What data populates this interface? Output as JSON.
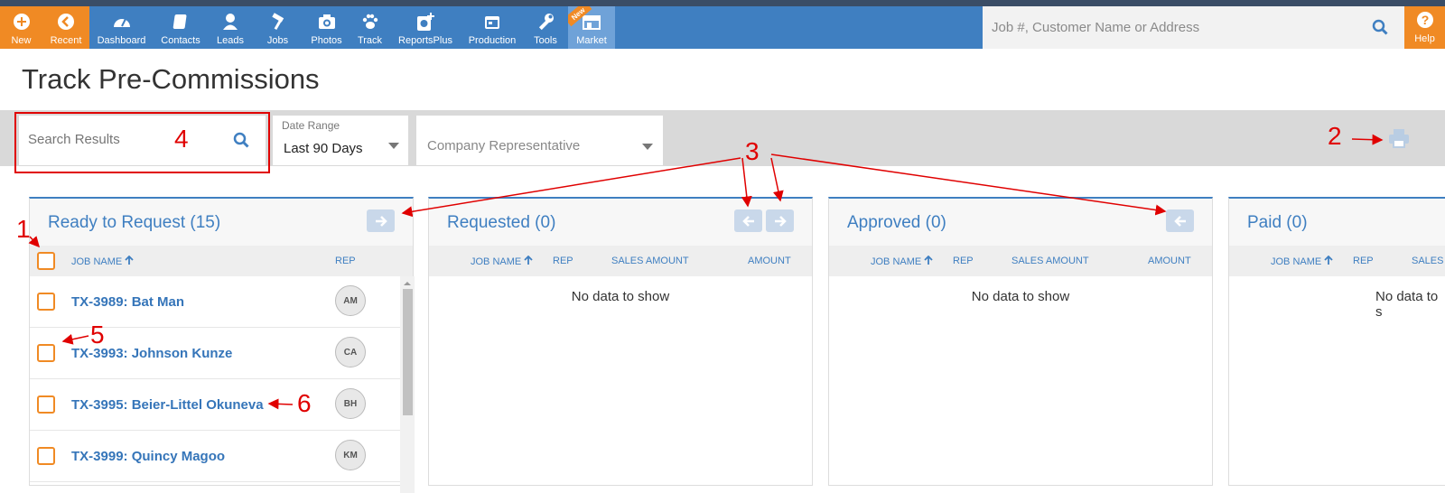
{
  "nav": {
    "new": "New",
    "recent": "Recent",
    "items": [
      "Dashboard",
      "Contacts",
      "Leads",
      "Jobs",
      "Photos",
      "Track",
      "ReportsPlus",
      "Production",
      "Tools",
      "Market"
    ],
    "new_badge": "New",
    "search_placeholder": "Job #, Customer Name or Address",
    "help": "Help"
  },
  "page": {
    "title": "Track Pre-Commissions"
  },
  "filters": {
    "search_placeholder": "Search Results",
    "date_range_label": "Date Range",
    "date_range_value": "Last 90 Days",
    "company_rep_placeholder": "Company Representative"
  },
  "annotations": [
    "1",
    "2",
    "3",
    "4",
    "5",
    "6"
  ],
  "panels": {
    "ready": {
      "title": "Ready to Request (15)",
      "col_job": "JOB NAME",
      "col_rep": "REP",
      "rows": [
        {
          "job": "TX-3989: Bat Man",
          "rep": "AM"
        },
        {
          "job": "TX-3993: Johnson Kunze",
          "rep": "CA"
        },
        {
          "job": "TX-3995: Beier-Littel Okuneva",
          "rep": "BH"
        },
        {
          "job": "TX-3999: Quincy Magoo",
          "rep": "KM"
        }
      ]
    },
    "requested": {
      "title": "Requested (0)",
      "col_job": "JOB NAME",
      "col_rep": "REP",
      "col_sales": "SALES AMOUNT",
      "col_amount": "AMOUNT",
      "empty": "No data to show"
    },
    "approved": {
      "title": "Approved (0)",
      "col_job": "JOB NAME",
      "col_rep": "REP",
      "col_sales": "SALES AMOUNT",
      "col_amount": "AMOUNT",
      "empty": "No data to show"
    },
    "paid": {
      "title": "Paid (0)",
      "col_job": "JOB NAME",
      "col_rep": "REP",
      "col_sales": "SALES A",
      "empty": "No data to s"
    }
  },
  "colors": {
    "brand_blue": "#3f7fc1",
    "orange": "#f08a24",
    "annotation_red": "#e00000"
  }
}
